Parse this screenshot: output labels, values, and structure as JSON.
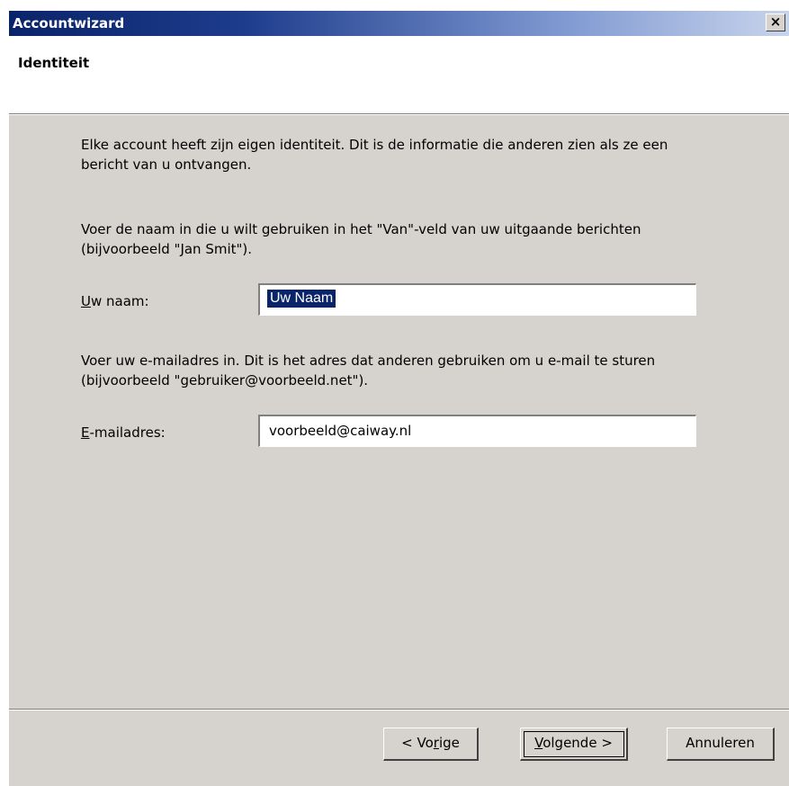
{
  "window": {
    "title": "Accountwizard",
    "close_glyph": "×"
  },
  "header": {
    "title": "Identiteit"
  },
  "main": {
    "intro_text": "Elke account heeft zijn eigen identiteit. Dit is de informatie die anderen zien als ze een bericht van u ontvangen.",
    "name_instructions": "Voer de naam in die u wilt gebruiken in het \"Van\"-veld van uw uitgaande berichten (bijvoorbeeld \"Jan Smit\").",
    "name_label_accel": "U",
    "name_label_rest": "w naam:",
    "name_value": "Uw Naam",
    "email_instructions": "Voer uw e-mailadres in. Dit is het adres dat anderen gebruiken om u e-mail te sturen (bijvoorbeeld \"gebruiker@voorbeeld.net\").",
    "email_label_accel": "E",
    "email_label_rest": "-mailadres:",
    "email_value": "voorbeeld@caiway.nl"
  },
  "buttons": {
    "back_pre": "< Vo",
    "back_accel": "r",
    "back_post": "ige",
    "next_accel": "V",
    "next_post": "olgende >",
    "cancel": "Annuleren"
  },
  "colors": {
    "titlebar_start": "#0a246a",
    "dialog_background": "#d6d3ce",
    "selection": "#0a246a"
  }
}
